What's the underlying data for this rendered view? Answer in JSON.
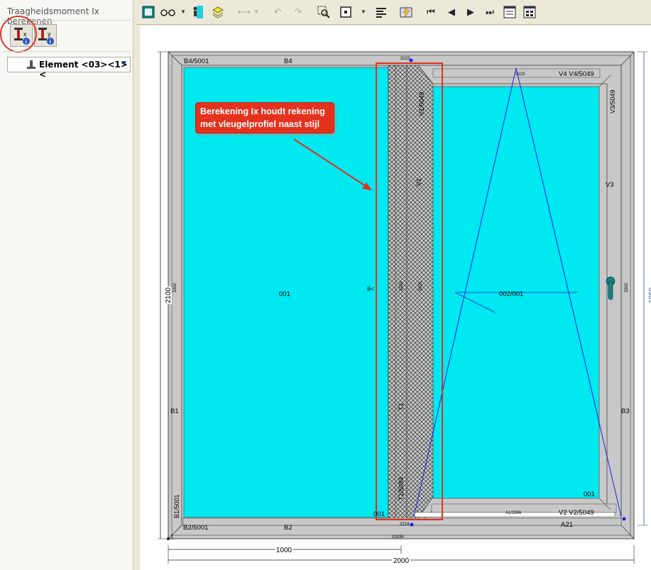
{
  "panel": {
    "title": "Traagheidsmoment Ix berekenen",
    "buttons": [
      {
        "name": "ix-info-button",
        "letter": "x"
      },
      {
        "name": "iy-info-button",
        "letter": "y"
      }
    ],
    "element_select": "Element <03><1><"
  },
  "callout": {
    "line1": "Berekening Ix houdt rekening",
    "line2": "met vleugelprofiel naast stijl"
  },
  "drawing": {
    "labels": {
      "b4_5001": "B4/5001",
      "b4": "B4",
      "b1": "B1",
      "b1_5001": "B1/5001",
      "b2_5001": "B2/5001",
      "b2": "B2",
      "b3": "B3",
      "v4_v4_5049": "V4 V4/5049",
      "v3_5049": "V3/5049",
      "v3": "V3",
      "v1_5049": "V1/5049",
      "v1": "V1",
      "t1": "T1",
      "t1_5084": "T1/5084",
      "v2_v2_5049": "V2 V2/5049",
      "a1_3306": "A1/3306",
      "a21": "A21",
      "i_3336": "I/3336",
      "left_pane": "001",
      "left_pane_bottom": "001",
      "right_pane": "002/001",
      "right_pane_bottom": "001",
      "sash_code": "3223",
      "frame_code": "3302",
      "frame_code_right": "3302",
      "mid_code": "3224",
      "mid_code2": "3223",
      "corner_top": "3223",
      "corner_bottom": "3224",
      "origin": "1",
      "ii_marker": "II<"
    },
    "dimensions": {
      "height": "2100",
      "height_right": "1050",
      "width_total": "2000",
      "width_left": "1000"
    },
    "colors": {
      "glass": "#00e8f0",
      "profile": "#c8c8c8",
      "frame_dark": "#555555",
      "annotation_red": "#e03020",
      "opening_line": "#2020e0",
      "handle": "#1a8080"
    }
  }
}
